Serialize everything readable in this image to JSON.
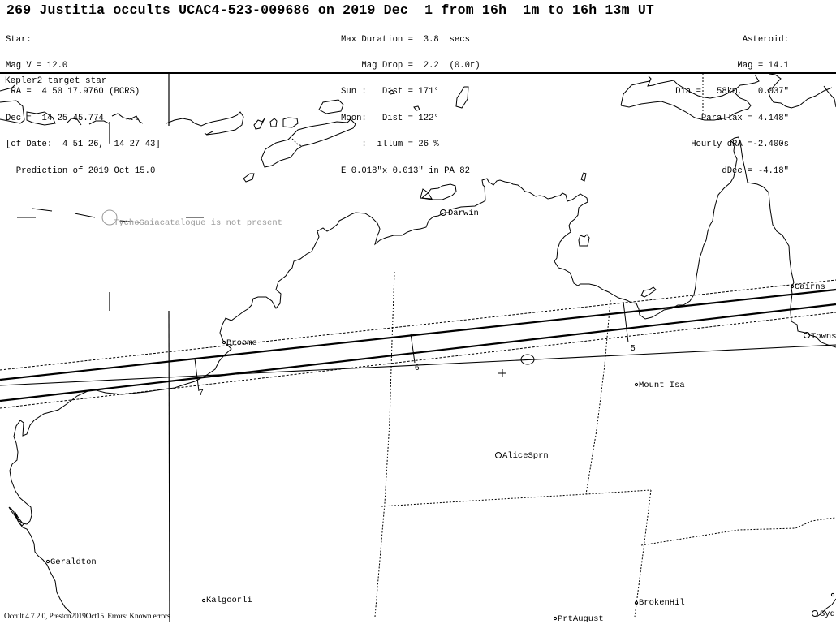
{
  "header": {
    "title": "269 Justitia occults UCAC4-523-009686 on 2019 Dec  1 from 16h  1m to 16h 13m UT",
    "star": [
      "Star:",
      "Mag V = 12.0",
      " RA =  4 50 17.9760 (BCRS)",
      "Dec =  14 25 45.774    ...",
      "[of Date:  4 51 26,  14 27 43]",
      "  Prediction of 2019 Oct 15.0"
    ],
    "event": [
      "Max Duration =  3.8  secs",
      "    Mag Drop =  2.2  (0.0r)",
      "Sun :   Dist = 171°",
      "Moon:   Dist = 122°",
      "    :  illum = 26 %",
      "E 0.018\"x 0.013\" in PA 82"
    ],
    "asteroid": [
      "Asteroid:",
      "  Mag = 14.1",
      "  Dia =   58km,   0.037\"",
      "Parallax = 4.148\"",
      "Hourly dRA =-2.400s",
      "dDec = -4.18\""
    ]
  },
  "map": {
    "note": "Kepler2 target star",
    "catalogue_warning": "TychoGaiacatalogue is not present",
    "path_time_ticks": [
      {
        "label": "7"
      },
      {
        "label": "6"
      },
      {
        "label": "5"
      }
    ],
    "cities": [
      {
        "name": "Darwin"
      },
      {
        "name": "Broome"
      },
      {
        "name": "Cairns"
      },
      {
        "name": "Towns"
      },
      {
        "name": "Mount Isa"
      },
      {
        "name": "AliceSprn"
      },
      {
        "name": "Geraldton"
      },
      {
        "name": "Kalgoorli"
      },
      {
        "name": "BrokenHil"
      },
      {
        "name": "PrtAugust"
      },
      {
        "name": "Syd"
      }
    ],
    "colors": {
      "path_line": "#000000",
      "border_dotted": "#000000",
      "warning_text": "#9a9a9a",
      "background": "#ffffff"
    }
  },
  "footer": {
    "text": "Occult 4.7.2.0, Preston2019Oct15  Errors: Known errors"
  }
}
